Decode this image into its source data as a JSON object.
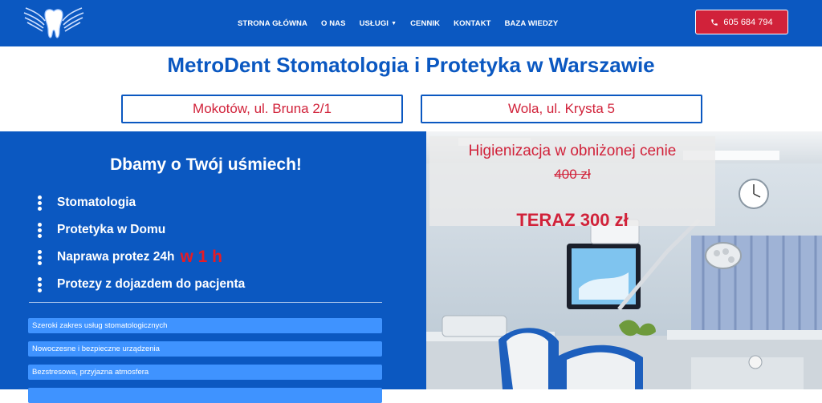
{
  "header": {
    "nav": [
      {
        "label": "STRONA GŁÓWNA",
        "has_dropdown": false
      },
      {
        "label": "O NAS",
        "has_dropdown": false
      },
      {
        "label": "USŁUGI",
        "has_dropdown": true
      },
      {
        "label": "CENNIK",
        "has_dropdown": false
      },
      {
        "label": "KONTAKT",
        "has_dropdown": false
      },
      {
        "label": "BAZA WIEDZY",
        "has_dropdown": false
      }
    ],
    "phone": "605 684 794"
  },
  "main": {
    "title": "MetroDent Stomatologia i Protetyka w Warszawie",
    "locations": [
      "Mokotów, ul. Bruna 2/1",
      "Wola, ul. Krysta 5"
    ]
  },
  "left_panel": {
    "heading": "Dbamy o Twój uśmiech!",
    "list": [
      {
        "text": "Stomatologia",
        "highlight": ""
      },
      {
        "text": "Protetyka w Domu",
        "highlight": ""
      },
      {
        "text": "Naprawa protez 24h",
        "highlight": "w 1 h"
      },
      {
        "text": "Protezy z dojazdem do pacjenta",
        "highlight": ""
      }
    ],
    "features": [
      "Szeroki zakres usług stomatologicznych",
      "Nowoczesne i bezpieczne urządzenia",
      "Bezstresowa, przyjazna atmosfera"
    ]
  },
  "promo": {
    "title": "Higienizacja w obniżonej cenie",
    "old_price": "400 zł",
    "new_price": "TERAZ 300 zł"
  },
  "colors": {
    "brand_blue": "#0b58c1",
    "accent_red": "#d1223a",
    "feature_blue": "#3f93ff"
  },
  "icons": {
    "logo": "winged-tooth-logo",
    "phone": "phone-icon",
    "dropdown": "chevron-down-icon",
    "bullet": "vertical-dots-icon"
  }
}
